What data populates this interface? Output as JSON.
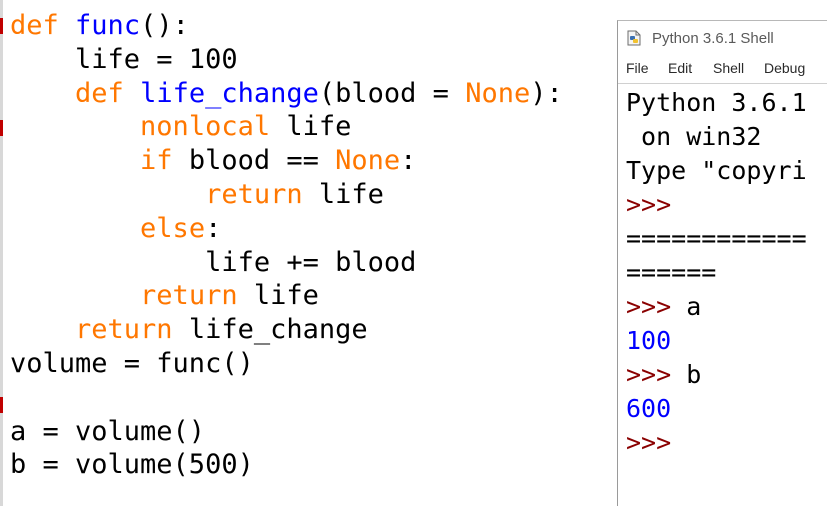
{
  "colors": {
    "keyword": "#ff7700",
    "definition": "#0000ff",
    "plain": "#000000",
    "prompt": "#8a0000",
    "stdout": "#0000ff",
    "edge_marker": "#c00000"
  },
  "editor": {
    "lines": [
      [
        {
          "t": "def",
          "c": "kw"
        },
        {
          "t": " ",
          "c": "plain"
        },
        {
          "t": "func",
          "c": "def"
        },
        {
          "t": "():",
          "c": "plain"
        }
      ],
      [
        {
          "t": "    life = 100",
          "c": "plain"
        }
      ],
      [
        {
          "t": "    ",
          "c": "plain"
        },
        {
          "t": "def",
          "c": "kw"
        },
        {
          "t": " ",
          "c": "plain"
        },
        {
          "t": "life_change",
          "c": "def"
        },
        {
          "t": "(blood = ",
          "c": "plain"
        },
        {
          "t": "None",
          "c": "kw"
        },
        {
          "t": "):",
          "c": "plain"
        }
      ],
      [
        {
          "t": "        ",
          "c": "plain"
        },
        {
          "t": "nonlocal",
          "c": "kw"
        },
        {
          "t": " life",
          "c": "plain"
        }
      ],
      [
        {
          "t": "        ",
          "c": "plain"
        },
        {
          "t": "if",
          "c": "kw"
        },
        {
          "t": " blood == ",
          "c": "plain"
        },
        {
          "t": "None",
          "c": "kw"
        },
        {
          "t": ":",
          "c": "plain"
        }
      ],
      [
        {
          "t": "            ",
          "c": "plain"
        },
        {
          "t": "return",
          "c": "kw"
        },
        {
          "t": " life",
          "c": "plain"
        }
      ],
      [
        {
          "t": "        ",
          "c": "plain"
        },
        {
          "t": "else",
          "c": "kw"
        },
        {
          "t": ":",
          "c": "plain"
        }
      ],
      [
        {
          "t": "            life += blood",
          "c": "plain"
        }
      ],
      [
        {
          "t": "        ",
          "c": "plain"
        },
        {
          "t": "return",
          "c": "kw"
        },
        {
          "t": " life",
          "c": "plain"
        }
      ],
      [
        {
          "t": "    ",
          "c": "plain"
        },
        {
          "t": "return",
          "c": "kw"
        },
        {
          "t": " life_change",
          "c": "plain"
        }
      ],
      [
        {
          "t": "volume = func()",
          "c": "plain"
        }
      ],
      [
        {
          "t": "",
          "c": "plain"
        }
      ],
      [
        {
          "t": "a = volume()",
          "c": "plain"
        }
      ],
      [
        {
          "t": "b = volume(500)",
          "c": "plain"
        }
      ]
    ]
  },
  "shell": {
    "title": "Python 3.6.1 Shell",
    "icon": "python-file-icon",
    "menu": [
      "File",
      "Edit",
      "Shell",
      "Debug"
    ],
    "output": [
      [
        {
          "t": "Python 3.6.1",
          "c": "text"
        }
      ],
      [
        {
          "t": " on win32",
          "c": "text"
        }
      ],
      [
        {
          "t": "Type \"copyri",
          "c": "text"
        }
      ],
      [
        {
          "t": ">>>",
          "c": "prompt"
        }
      ],
      [
        {
          "t": "============",
          "c": "text"
        }
      ],
      [
        {
          "t": "======",
          "c": "text"
        }
      ],
      [
        {
          "t": ">>>",
          "c": "prompt"
        },
        {
          "t": " a",
          "c": "text"
        }
      ],
      [
        {
          "t": "100",
          "c": "stdout"
        }
      ],
      [
        {
          "t": ">>>",
          "c": "prompt"
        },
        {
          "t": " b",
          "c": "text"
        }
      ],
      [
        {
          "t": "600",
          "c": "stdout"
        }
      ],
      [
        {
          "t": ">>>",
          "c": "prompt"
        }
      ]
    ]
  }
}
